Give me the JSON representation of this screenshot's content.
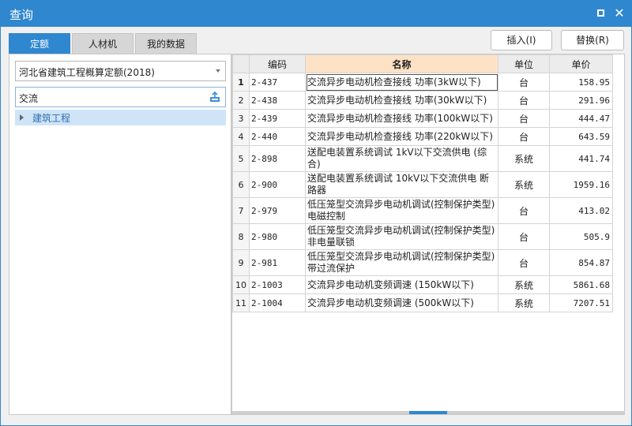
{
  "window": {
    "title": "查询"
  },
  "tabs": [
    {
      "label": "定额"
    },
    {
      "label": "人材机"
    },
    {
      "label": "我的数据"
    }
  ],
  "actions": {
    "insert_label": "插入(I)",
    "replace_label": "替换(R)"
  },
  "left": {
    "library": "河北省建筑工程概算定额(2018)",
    "search_value": "交流",
    "tree": [
      {
        "label": "建筑工程"
      }
    ]
  },
  "table": {
    "headers": {
      "code": "编码",
      "name": "名称",
      "unit": "单位",
      "price": "单价"
    },
    "rows": [
      {
        "n": "1",
        "code": "2-437",
        "name": "交流异步电动机检查接线 功率(3kW以下)",
        "unit": "台",
        "price": "158.95"
      },
      {
        "n": "2",
        "code": "2-438",
        "name": "交流异步电动机检查接线 功率(30kW以下)",
        "unit": "台",
        "price": "291.96"
      },
      {
        "n": "3",
        "code": "2-439",
        "name": "交流异步电动机检查接线 功率(100kW以下)",
        "unit": "台",
        "price": "444.47"
      },
      {
        "n": "4",
        "code": "2-440",
        "name": "交流异步电动机检查接线 功率(220kW以下)",
        "unit": "台",
        "price": "643.59"
      },
      {
        "n": "5",
        "code": "2-898",
        "name": "送配电装置系统调试 1kV以下交流供电 (综合)",
        "unit": "系统",
        "price": "441.74"
      },
      {
        "n": "6",
        "code": "2-900",
        "name": "送配电装置系统调试 10kV以下交流供电 断路器",
        "unit": "系统",
        "price": "1959.16"
      },
      {
        "n": "7",
        "code": "2-979",
        "name": "低压笼型交流异步电动机调试(控制保护类型)电磁控制",
        "unit": "台",
        "price": "413.02"
      },
      {
        "n": "8",
        "code": "2-980",
        "name": "低压笼型交流异步电动机调试(控制保护类型)非电量联锁",
        "unit": "台",
        "price": "505.9"
      },
      {
        "n": "9",
        "code": "2-981",
        "name": "低压笼型交流异步电动机调试(控制保护类型)带过流保护",
        "unit": "台",
        "price": "854.87"
      },
      {
        "n": "10",
        "code": "2-1003",
        "name": "交流异步电动机变频调速 (150kW以下)",
        "unit": "系统",
        "price": "5861.68"
      },
      {
        "n": "11",
        "code": "2-1004",
        "name": "交流异步电动机变频调速 (500kW以下)",
        "unit": "系统",
        "price": "7207.51"
      }
    ]
  }
}
